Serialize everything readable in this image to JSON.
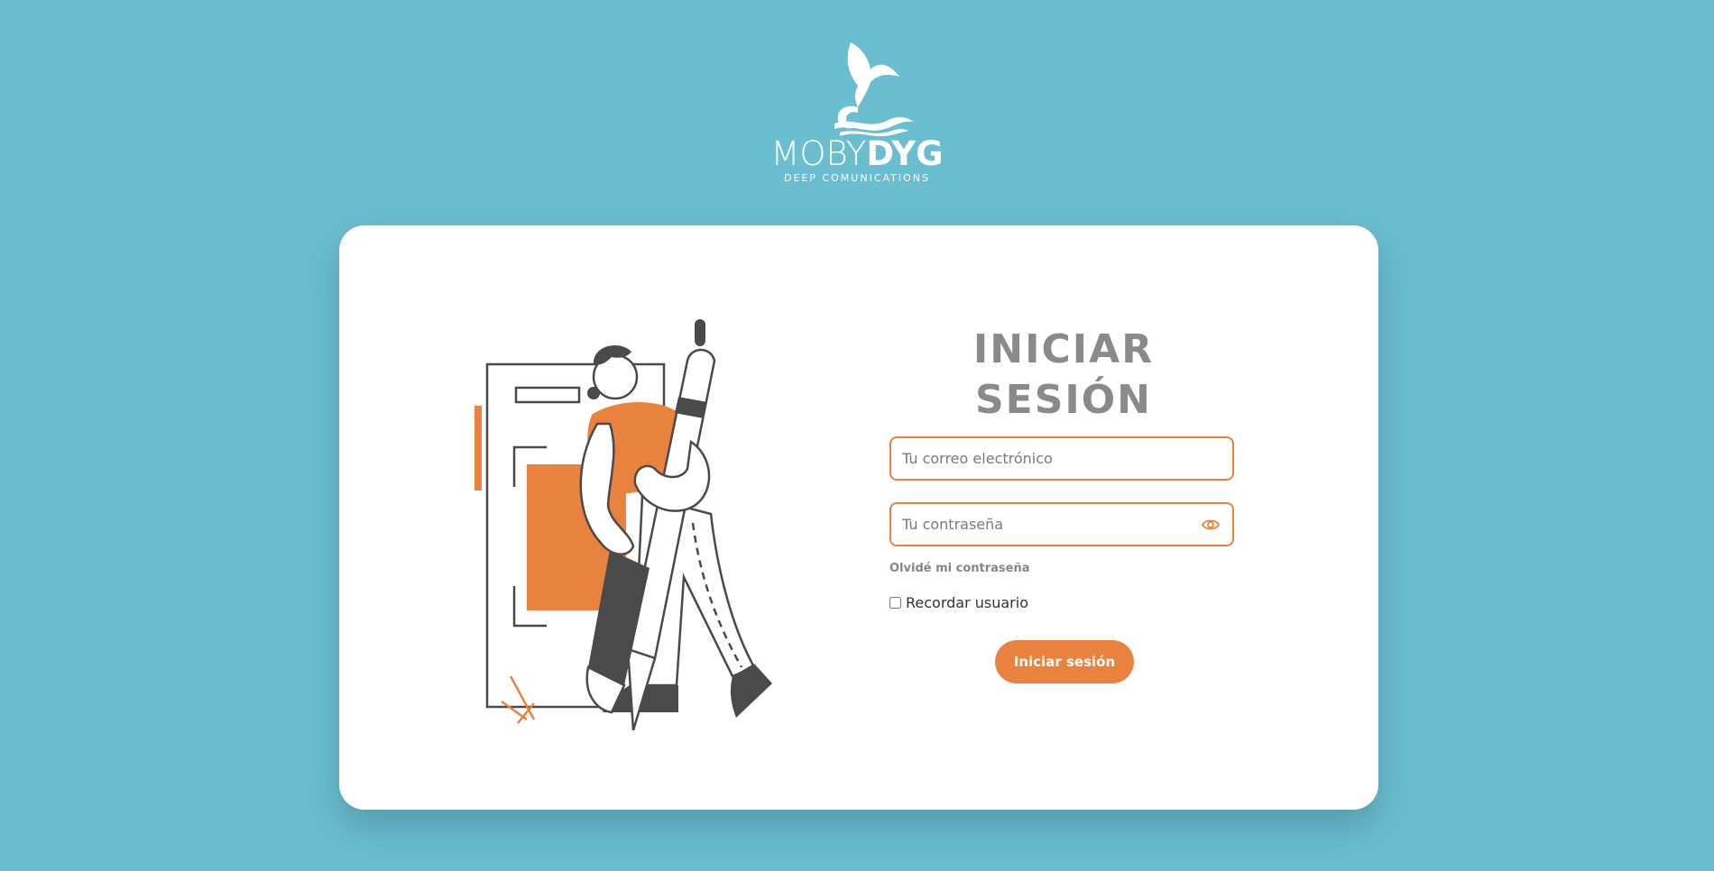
{
  "brand": {
    "name_light": "MOBY",
    "name_bold": "DYG",
    "tagline": "DEEP COMUNICATIONS"
  },
  "login": {
    "title": "INICIAR SESIÓN",
    "email_placeholder": "Tu correo electrónico",
    "password_placeholder": "Tu contraseña",
    "forgot_password": "Olvidé mi contraseña",
    "remember_label": "Recordar usuario",
    "remember_checked": false,
    "submit_label": "Iniciar sesión"
  },
  "icons": {
    "logo": "whale-tail-logo-icon",
    "password_toggle": "eye-icon"
  },
  "colors": {
    "background": "#6bbecf",
    "accent": "#e9823f",
    "title": "#8a8a8a",
    "card": "#ffffff",
    "illustration_dark": "#4a4a4a"
  }
}
